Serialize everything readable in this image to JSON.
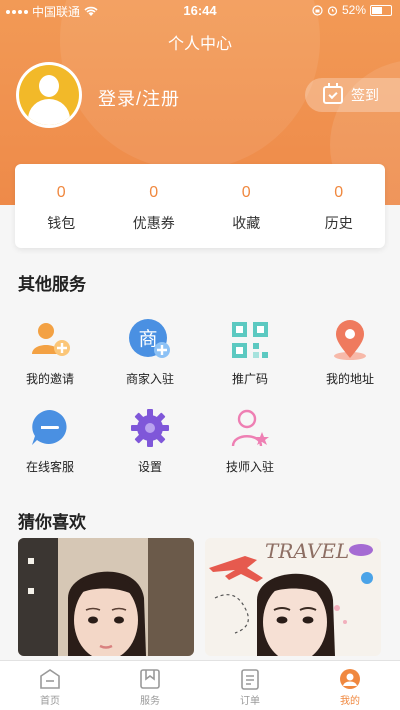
{
  "status_bar": {
    "carrier": "中国联通",
    "time": "16:44",
    "battery": "52%"
  },
  "header": {
    "title": "个人中心",
    "login_label": "登录/注册",
    "checkin_label": "签到",
    "accent_color": "#ef8c4a"
  },
  "stats": [
    {
      "value": "0",
      "label": "钱包"
    },
    {
      "value": "0",
      "label": "优惠券"
    },
    {
      "value": "0",
      "label": "收藏"
    },
    {
      "value": "0",
      "label": "历史"
    }
  ],
  "other_services": {
    "title": "其他服务",
    "items": [
      {
        "label": "我的邀请",
        "icon": "invite-user-icon"
      },
      {
        "label": "商家入驻",
        "icon": "merchant-icon"
      },
      {
        "label": "推广码",
        "icon": "qr-code-icon"
      },
      {
        "label": "我的地址",
        "icon": "location-pin-icon"
      },
      {
        "label": "在线客服",
        "icon": "chat-icon"
      },
      {
        "label": "设置",
        "icon": "gear-icon"
      },
      {
        "label": "技师入驻",
        "icon": "technician-icon"
      }
    ],
    "merchant_glyph": "商"
  },
  "guess_you_like": {
    "title": "猜你喜欢",
    "card2_overlay_text": "TRAVEL"
  },
  "tab_bar": {
    "items": [
      {
        "label": "首页",
        "icon": "home-icon"
      },
      {
        "label": "服务",
        "icon": "service-icon"
      },
      {
        "label": "订单",
        "icon": "order-icon"
      },
      {
        "label": "我的",
        "icon": "profile-icon"
      }
    ],
    "active_index": 3
  }
}
